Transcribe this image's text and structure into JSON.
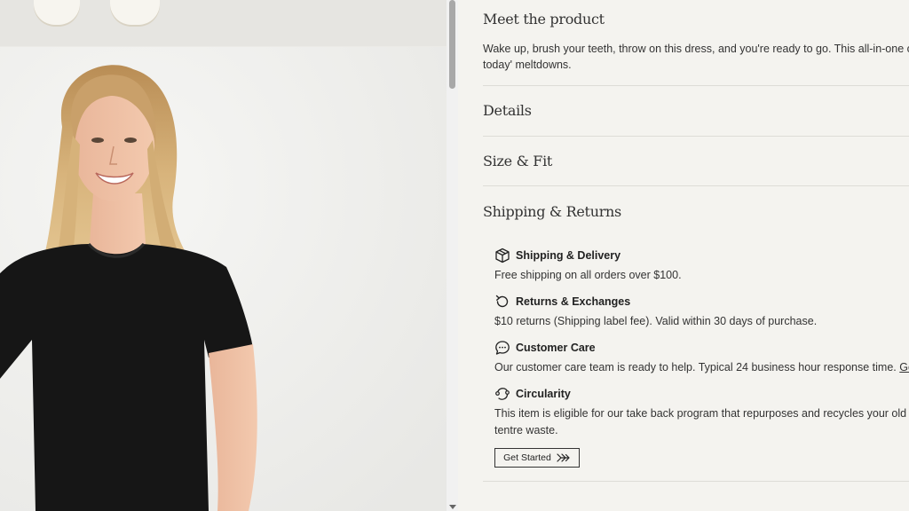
{
  "product_info": {
    "meet_title": "Meet the product",
    "meet_description": "Wake up, brush your teeth, throw on this dress, and you're ready to go. This all-in-one outfit w what to wear today' meltdowns.",
    "sections": [
      {
        "label": "Details"
      },
      {
        "label": "Size & Fit"
      },
      {
        "label": "Shipping & Returns"
      }
    ]
  },
  "shipping": {
    "items": [
      {
        "icon": "box-icon",
        "title": "Shipping & Delivery",
        "text": "Free shipping on all orders over $100."
      },
      {
        "icon": "returns-icon",
        "title": "Returns & Exchanges",
        "text": "$10 returns (Shipping label fee). Valid within 30 days of purchase."
      },
      {
        "icon": "chat-icon",
        "title": "Customer Care",
        "text": "Our customer care team is ready to help. Typical 24 business hour response time. ",
        "link": "Get Start"
      },
      {
        "icon": "recycle-icon",
        "title": "Circularity",
        "text": "This item is eligible for our take back program that repurposes and recycles your old tentre waste."
      }
    ],
    "cta_label": "Get Started"
  },
  "colors": {
    "background": "#f4f3ef",
    "shirt": "#161616",
    "hair": "#cda670",
    "skin": "#f0c3a8",
    "divider": "#dddcd7"
  }
}
